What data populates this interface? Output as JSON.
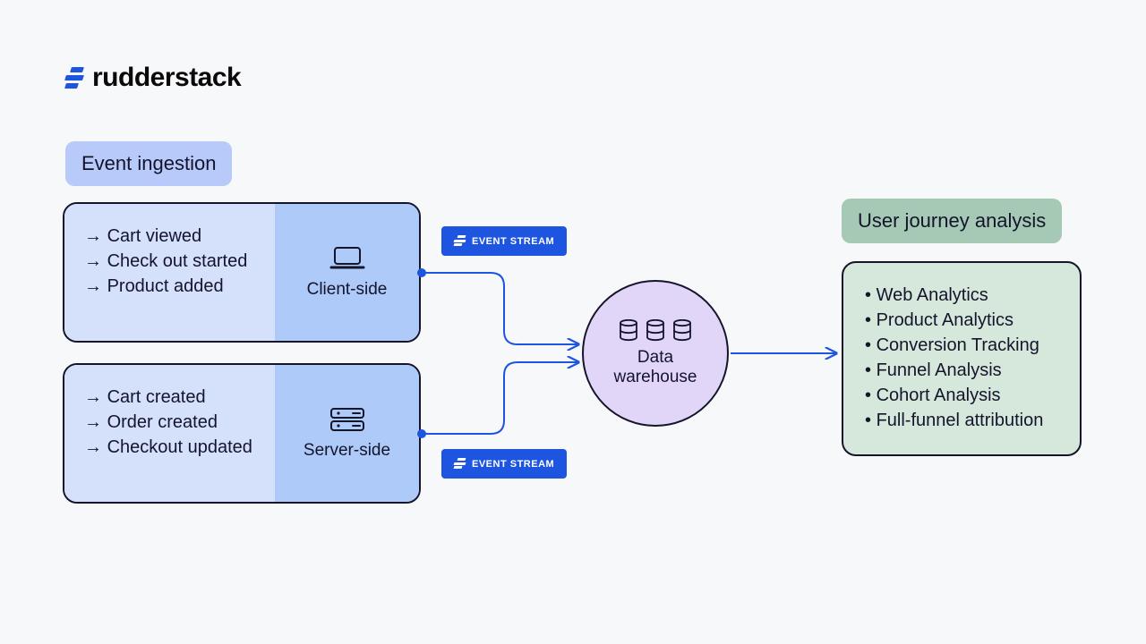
{
  "brand": {
    "name": "rudderstack"
  },
  "ingestion": {
    "title": "Event ingestion",
    "client": {
      "label": "Client-side",
      "events": [
        "Cart viewed",
        "Check out started",
        "Product added"
      ]
    },
    "server": {
      "label": "Server-side",
      "events": [
        "Cart created",
        "Order created",
        "Checkout updated"
      ]
    }
  },
  "event_stream_label": "EVENT STREAM",
  "warehouse": {
    "label": "Data\nwarehouse"
  },
  "analysis": {
    "title": "User journey analysis",
    "items": [
      "Web Analytics",
      "Product Analytics",
      "Conversion Tracking",
      "Funnel Analysis",
      "Cohort Analysis",
      "Full-funnel attribution"
    ]
  }
}
